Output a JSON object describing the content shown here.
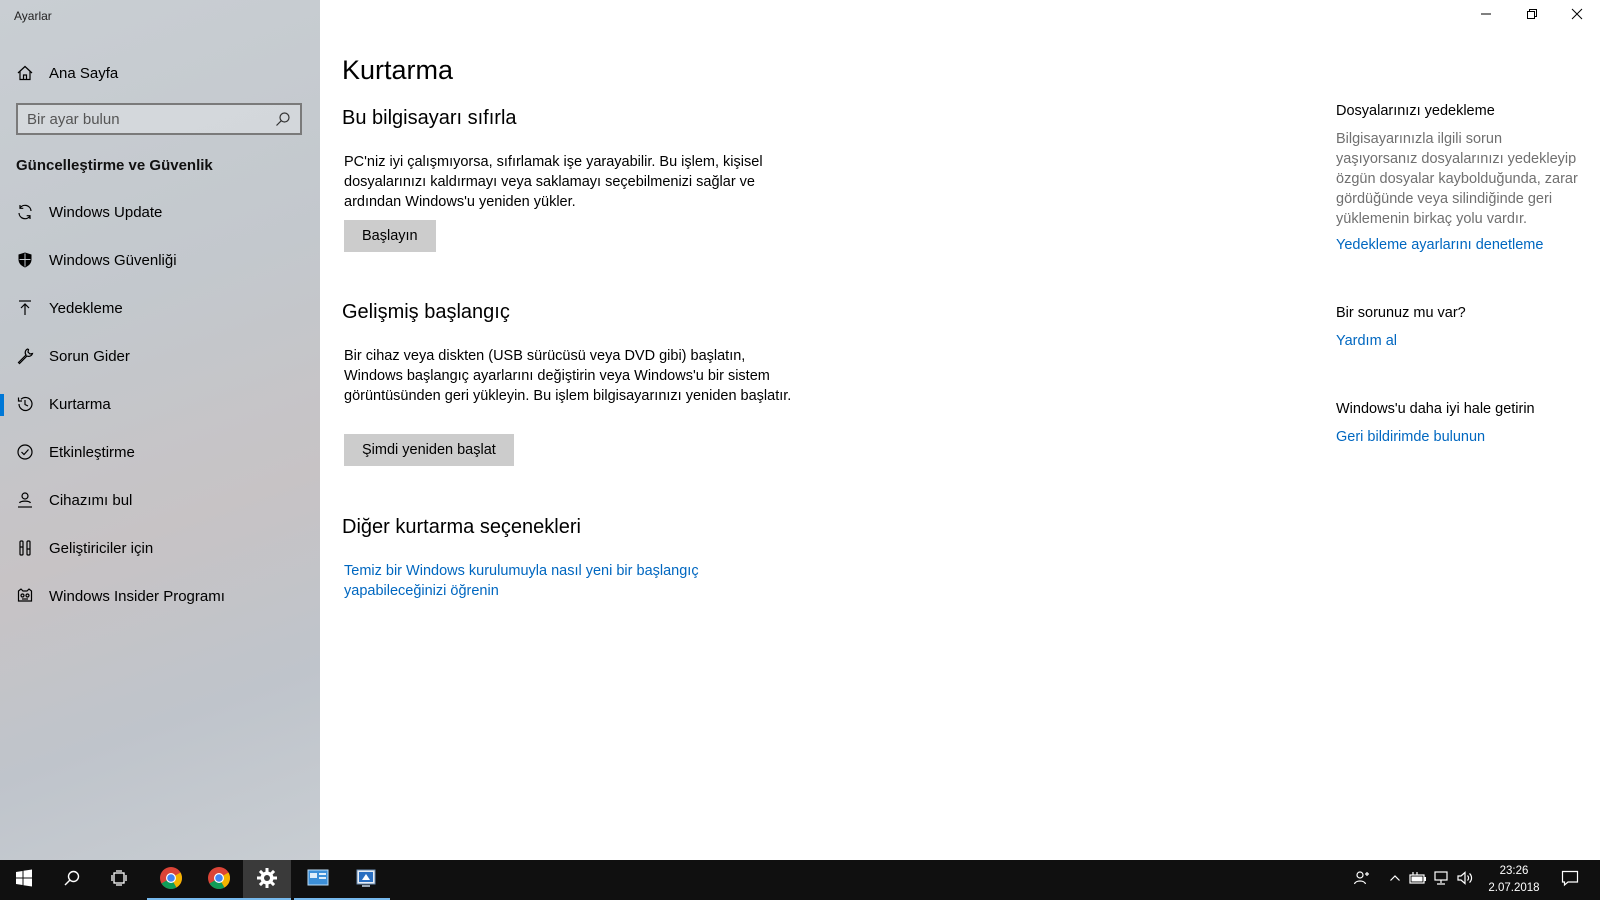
{
  "window": {
    "app_title": "Ayarlar",
    "controls": {
      "minimize": "minimize-icon",
      "restore": "restore-icon",
      "close": "close-icon"
    }
  },
  "sidebar": {
    "home_label": "Ana Sayfa",
    "search_placeholder": "Bir ayar bulun",
    "section_heading": "Güncelleştirme ve Güvenlik",
    "items": [
      {
        "label": "Windows Update",
        "icon": "refresh-icon",
        "active": false
      },
      {
        "label": "Windows Güvenliği",
        "icon": "shield-icon",
        "active": false
      },
      {
        "label": "Yedekleme",
        "icon": "upload-arrow-icon",
        "active": false
      },
      {
        "label": "Sorun Gider",
        "icon": "wrench-icon",
        "active": false
      },
      {
        "label": "Kurtarma",
        "icon": "history-icon",
        "active": true
      },
      {
        "label": "Etkinleştirme",
        "icon": "check-circle-icon",
        "active": false
      },
      {
        "label": "Cihazımı bul",
        "icon": "person-locate-icon",
        "active": false
      },
      {
        "label": "Geliştiriciler için",
        "icon": "developer-tools-icon",
        "active": false
      },
      {
        "label": "Windows Insider Programı",
        "icon": "insider-cat-icon",
        "active": false
      }
    ]
  },
  "main": {
    "title": "Kurtarma",
    "reset": {
      "heading": "Bu bilgisayarı sıfırla",
      "text": "PC'niz iyi çalışmıyorsa, sıfırlamak işe yarayabilir. Bu işlem, kişisel dosyalarınızı kaldırmayı veya saklamayı seçebilmenizi sağlar ve ardından Windows'u yeniden yükler.",
      "button": "Başlayın"
    },
    "advanced": {
      "heading": "Gelişmiş başlangıç",
      "text": "Bir cihaz veya diskten (USB sürücüsü veya DVD gibi) başlatın, Windows başlangıç ayarlarını değiştirin veya Windows'u bir sistem görüntüsünden geri yükleyin. Bu işlem bilgisayarınızı yeniden başlatır.",
      "button": "Şimdi yeniden başlat"
    },
    "other": {
      "heading": "Diğer kurtarma seçenekleri",
      "link": "Temiz bir Windows kurulumuyla nasıl yeni bir başlangıç yapabileceğinizi öğrenin"
    }
  },
  "right": {
    "backup_title": "Dosyalarınızı yedekleme",
    "backup_text": "Bilgisayarınızla ilgili sorun yaşıyorsanız dosyalarınızı yedekleyip özgün dosyalar kaybolduğunda, zarar gördüğünde veya silindiğinde geri yüklemenin birkaç yolu vardır.",
    "backup_link": "Yedekleme ayarlarını denetleme",
    "question_title": "Bir sorunuz mu var?",
    "help_link": "Yardım al",
    "improve_title": "Windows'u daha iyi hale getirin",
    "feedback_link": "Geri bildirimde bulunun"
  },
  "taskbar": {
    "pinned": [
      "start-icon",
      "search-icon",
      "task-view-icon",
      "chrome-icon",
      "chrome-icon",
      "settings-gear-icon",
      "control-panel-icon",
      "app-icon"
    ],
    "tray": [
      "people-icon",
      "chevron-up-icon",
      "battery-icon",
      "network-icon",
      "volume-icon"
    ],
    "time": "23:26",
    "date": "2.07.2018",
    "notification_icon": "action-center-icon"
  },
  "colors": {
    "accent": "#0078d7",
    "link": "#0067c0",
    "taskbar": "#101010",
    "button": "#cccccc"
  }
}
